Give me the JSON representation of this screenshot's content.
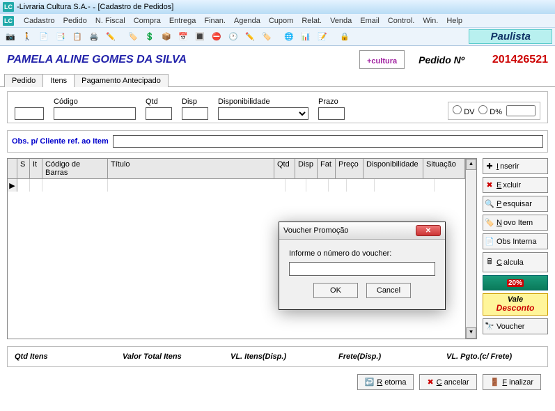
{
  "titlebar": {
    "app": "-Livraria Cultura S.A.-",
    "sub": "[Cadastro de Pedidos]"
  },
  "menu": {
    "items": [
      "Cadastro",
      "Pedido",
      "N. Fiscal",
      "Compra",
      "Entrega",
      "Finan.",
      "Agenda",
      "Cupom",
      "Relat.",
      "Venda",
      "Email",
      "Control.",
      "Win.",
      "Help"
    ]
  },
  "toolbar": {
    "brand": "Paulista"
  },
  "header": {
    "customer": "PAMELA ALINE GOMES DA SILVA",
    "logo_plus": "+",
    "logo_text": "cultura",
    "pedido_label": "Pedido Nº",
    "pedido_num": "201426521"
  },
  "tabs": {
    "t1": "Pedido",
    "t2": "Itens",
    "t3": "Pagamento Antecipado"
  },
  "fields": {
    "codigo": "Código",
    "qtd": "Qtd",
    "disp": "Disp",
    "disponibilidade": "Disponibilidade",
    "prazo": "Prazo",
    "dv": "DV",
    "dpct": "D%"
  },
  "obs": {
    "label": "Obs. p/ Cliente ref. ao Item",
    "value": ""
  },
  "grid": {
    "cols": {
      "s": "S",
      "it": "It",
      "codbar": "Código de Barras",
      "titulo": "Título",
      "qtd": "Qtd",
      "disp": "Disp",
      "fat": "Fat",
      "preco": "Preço",
      "dispon": "Disponibilidade",
      "sit": "Situação"
    }
  },
  "side": {
    "inserir": "Inserir",
    "excluir": "Excluir",
    "pesquisar": "Pesquisar",
    "novoitem": "Novo Item",
    "obsint": "Obs Interna",
    "calcula": "Calcula",
    "promo_pct": "20%",
    "vale_top": "Vale",
    "vale_bot": "Desconto",
    "voucher": "Voucher"
  },
  "footer": {
    "qtditens": "Qtd Itens",
    "valortotal": "Valor Total Itens",
    "vlitens": "VL. Itens(Disp.)",
    "frete": "Frete(Disp.)",
    "vlpgto": "VL. Pgto.(c/ Frete)"
  },
  "bottom": {
    "retorna": "Retorna",
    "cancelar": "Cancelar",
    "finalizar": "Finalizar"
  },
  "modal": {
    "title": "Voucher Promoção",
    "prompt": "Informe o número do voucher:",
    "value": "",
    "ok": "OK",
    "cancel": "Cancel"
  }
}
